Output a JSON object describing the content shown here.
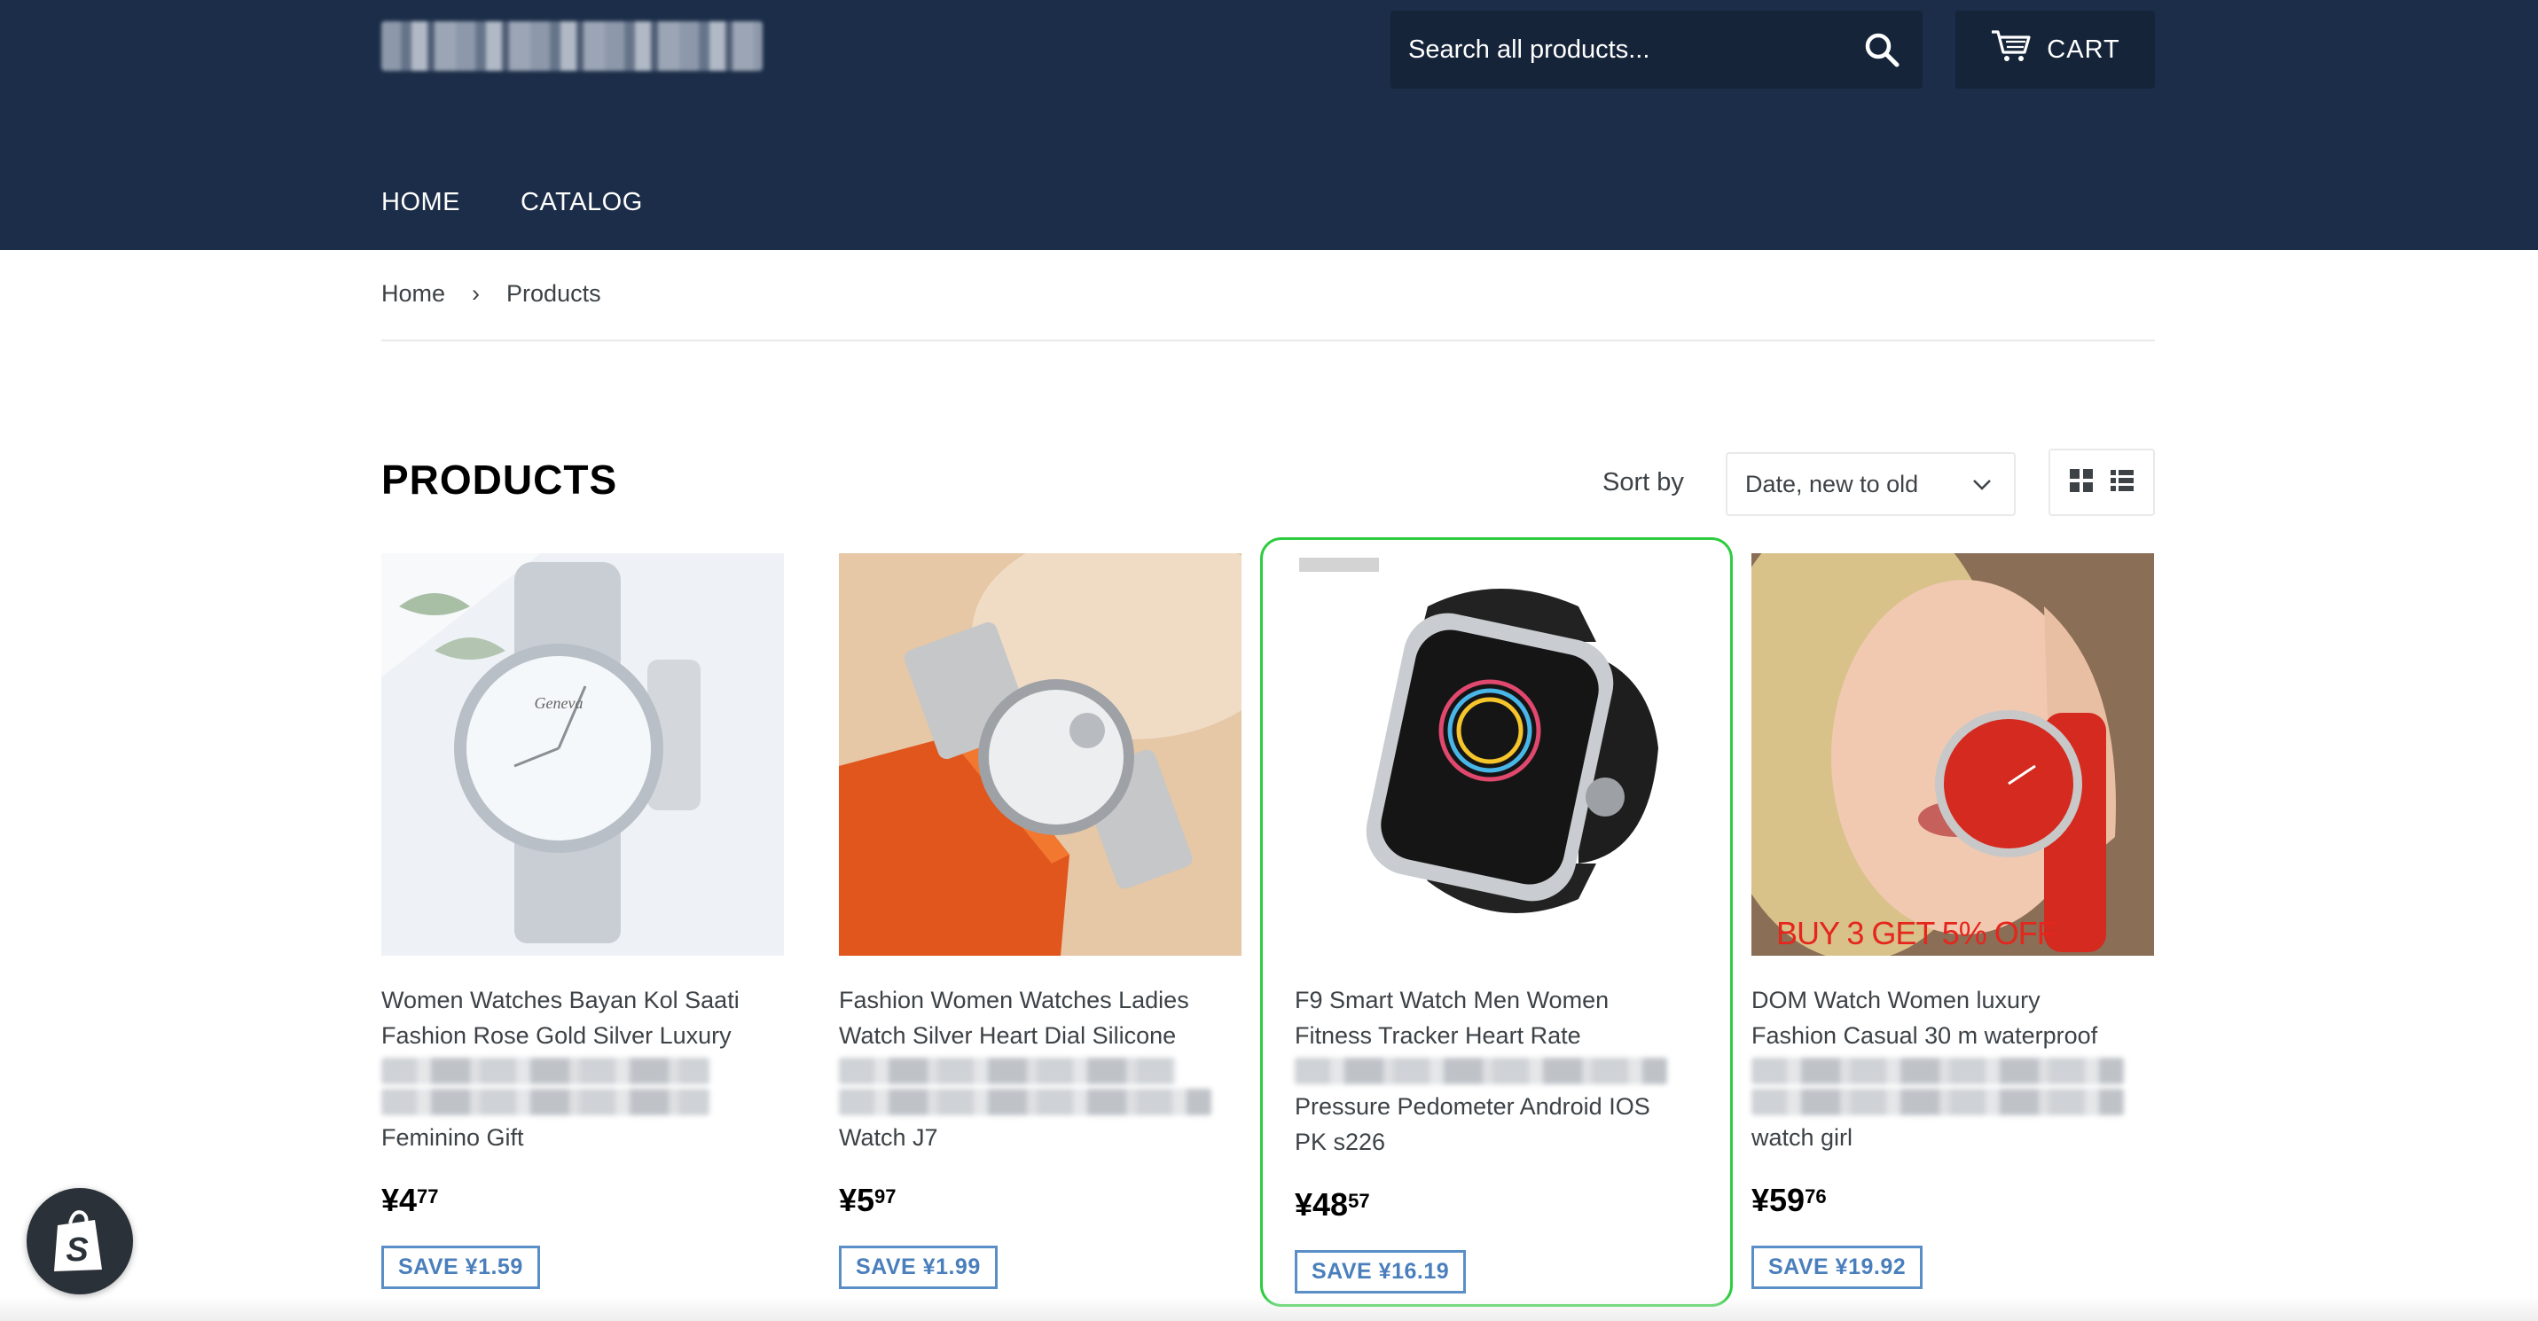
{
  "header": {
    "search_placeholder": "Search all products...",
    "cart_label": "CART",
    "nav": [
      {
        "label": "HOME"
      },
      {
        "label": "CATALOG"
      }
    ]
  },
  "breadcrumb": {
    "home": "Home",
    "separator": "›",
    "current": "Products"
  },
  "collection": {
    "title": "PRODUCTS",
    "sort_label": "Sort by",
    "sort_value": "Date, new to old"
  },
  "products": [
    {
      "title_line1": "Women Watches Bayan Kol Saati",
      "title_line2": "Fashion Rose Gold Silver Luxury",
      "title_last": "Feminino Gift",
      "price_main": "¥4",
      "price_cents": "77",
      "save": "SAVE ¥1.59"
    },
    {
      "title_line1": "Fashion Women Watches Ladies",
      "title_line2": "Watch Silver Heart Dial Silicone",
      "title_last": "Watch J7",
      "price_main": "¥5",
      "price_cents": "97",
      "save": "SAVE ¥1.99"
    },
    {
      "title_line1": "F9 Smart Watch Men Women",
      "title_line2": "Fitness Tracker Heart Rate",
      "title_line4": "Pressure Pedometer Android IOS",
      "title_last": "PK s226",
      "price_main": "¥48",
      "price_cents": "57",
      "save": "SAVE ¥16.19"
    },
    {
      "title_line1": "DOM Watch Women luxury",
      "title_line2": "Fashion Casual 30 m waterproof",
      "title_last": "watch girl",
      "price_main": "¥59",
      "price_cents": "76",
      "save": "SAVE ¥19.92",
      "promo": "BUY 3 GET 5% OFF"
    }
  ],
  "colors": {
    "header_bg": "#1b2d48",
    "save_badge": "#4a7fbc",
    "highlight": "#2ecc40"
  }
}
